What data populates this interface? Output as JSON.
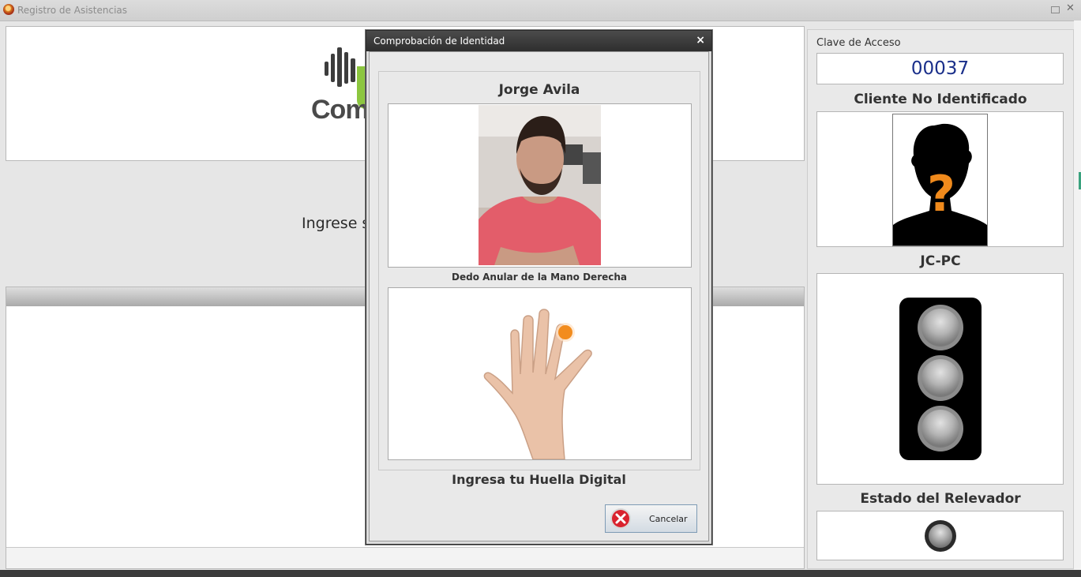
{
  "window": {
    "title": "Registro de Asistencias"
  },
  "logo": {
    "text": "Comp"
  },
  "main": {
    "prompt": "Ingrese s"
  },
  "right_panel": {
    "access_key_label": "Clave de Acceso",
    "access_key_value": "00037",
    "client_status": "Cliente No Identificado",
    "pc_name": "JC-PC",
    "relay_label": "Estado del Relevador"
  },
  "dialog": {
    "title": "Comprobación de Identidad",
    "close_glyph": "×",
    "person_name": "Jorge Avila",
    "finger_label": "Dedo Anular de la Mano Derecha",
    "instruction": "Ingresa tu Huella Digital",
    "cancel_label": "Cancelar"
  },
  "colors": {
    "access_key_text": "#1a2f8a",
    "logo_green": "#8cc63f",
    "finger_marker": "#f28c1e",
    "question_mark": "#f08a1c"
  },
  "icons": {
    "app": "app-icon",
    "restore": "restore-icon",
    "close": "close-icon",
    "cancel": "cancel-x-icon",
    "unknown_client": "unknown-person-icon",
    "traffic_light": "traffic-light-icon",
    "relay": "relay-light-icon",
    "hand": "hand-icon"
  }
}
